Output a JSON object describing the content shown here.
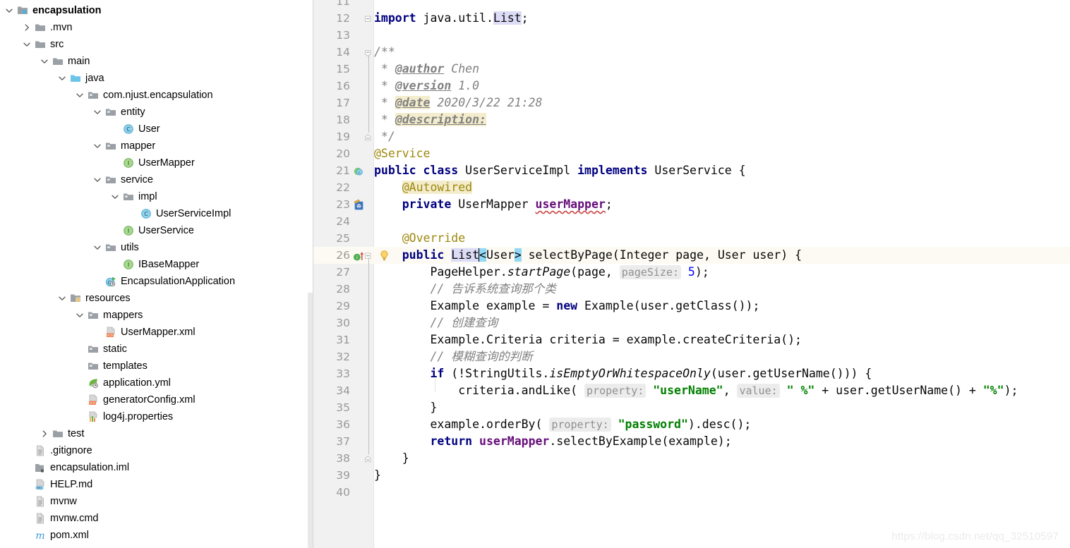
{
  "project_tree": {
    "name": "Project tool window",
    "items": [
      {
        "label": "encapsulation",
        "depth": 0,
        "arrow": "down",
        "icon": "module-folder-icon",
        "bold": true
      },
      {
        "label": ".mvn",
        "depth": 1,
        "arrow": "right",
        "icon": "folder-icon",
        "bold": false
      },
      {
        "label": "src",
        "depth": 1,
        "arrow": "down",
        "icon": "folder-icon",
        "bold": false
      },
      {
        "label": "main",
        "depth": 2,
        "arrow": "down",
        "icon": "folder-icon",
        "bold": false
      },
      {
        "label": "java",
        "depth": 3,
        "arrow": "down",
        "icon": "source-folder-icon",
        "bold": false
      },
      {
        "label": "com.njust.encapsulation",
        "depth": 4,
        "arrow": "down",
        "icon": "package-icon",
        "bold": false
      },
      {
        "label": "entity",
        "depth": 5,
        "arrow": "down",
        "icon": "package-icon",
        "bold": false
      },
      {
        "label": "User",
        "depth": 6,
        "arrow": "none",
        "icon": "java-class-icon",
        "bold": false
      },
      {
        "label": "mapper",
        "depth": 5,
        "arrow": "down",
        "icon": "package-icon",
        "bold": false
      },
      {
        "label": "UserMapper",
        "depth": 6,
        "arrow": "none",
        "icon": "java-interface-icon",
        "bold": false
      },
      {
        "label": "service",
        "depth": 5,
        "arrow": "down",
        "icon": "package-icon",
        "bold": false
      },
      {
        "label": "impl",
        "depth": 6,
        "arrow": "down",
        "icon": "package-icon",
        "bold": false
      },
      {
        "label": "UserServiceImpl",
        "depth": 7,
        "arrow": "none",
        "icon": "java-class-icon",
        "bold": false
      },
      {
        "label": "UserService",
        "depth": 6,
        "arrow": "none",
        "icon": "java-interface-icon",
        "bold": false
      },
      {
        "label": "utils",
        "depth": 5,
        "arrow": "down",
        "icon": "package-icon",
        "bold": false
      },
      {
        "label": "IBaseMapper",
        "depth": 6,
        "arrow": "none",
        "icon": "java-interface-icon",
        "bold": false
      },
      {
        "label": "EncapsulationApplication",
        "depth": 5,
        "arrow": "none",
        "icon": "spring-boot-class-icon",
        "bold": false
      },
      {
        "label": "resources",
        "depth": 3,
        "arrow": "down",
        "icon": "resources-folder-icon",
        "bold": false
      },
      {
        "label": "mappers",
        "depth": 4,
        "arrow": "down",
        "icon": "package-icon",
        "bold": false
      },
      {
        "label": "UserMapper.xml",
        "depth": 5,
        "arrow": "none",
        "icon": "xml-file-icon",
        "bold": false
      },
      {
        "label": "static",
        "depth": 4,
        "arrow": "none",
        "icon": "package-icon",
        "bold": false
      },
      {
        "label": "templates",
        "depth": 4,
        "arrow": "none",
        "icon": "package-icon",
        "bold": false
      },
      {
        "label": "application.yml",
        "depth": 4,
        "arrow": "none",
        "icon": "spring-yml-icon",
        "bold": false
      },
      {
        "label": "generatorConfig.xml",
        "depth": 4,
        "arrow": "none",
        "icon": "xml-file-icon",
        "bold": false
      },
      {
        "label": "log4j.properties",
        "depth": 4,
        "arrow": "none",
        "icon": "properties-file-icon",
        "bold": false
      },
      {
        "label": "test",
        "depth": 2,
        "arrow": "right",
        "icon": "folder-icon",
        "bold": false
      },
      {
        "label": ".gitignore",
        "depth": 1,
        "arrow": "none",
        "icon": "text-file-icon",
        "bold": false
      },
      {
        "label": "encapsulation.iml",
        "depth": 1,
        "arrow": "none",
        "icon": "iml-file-icon",
        "bold": false
      },
      {
        "label": "HELP.md",
        "depth": 1,
        "arrow": "none",
        "icon": "markdown-file-icon",
        "bold": false
      },
      {
        "label": "mvnw",
        "depth": 1,
        "arrow": "none",
        "icon": "text-file-icon",
        "bold": false
      },
      {
        "label": "mvnw.cmd",
        "depth": 1,
        "arrow": "none",
        "icon": "text-file-icon",
        "bold": false
      },
      {
        "label": "pom.xml",
        "depth": 1,
        "arrow": "none",
        "icon": "maven-pom-icon",
        "bold": false
      }
    ]
  },
  "editor": {
    "name": "UserServiceImpl.java",
    "first_visible_line": 11,
    "current_line": 26,
    "caret_line": 26,
    "lines": [
      {
        "n": 12,
        "text": "import java.util.List;"
      },
      {
        "n": 13,
        "text": ""
      },
      {
        "n": 14,
        "text": "/**"
      },
      {
        "n": 15,
        "text": " * @author Chen"
      },
      {
        "n": 16,
        "text": " * @version 1.0"
      },
      {
        "n": 17,
        "text": " * @date 2020/3/22 21:28"
      },
      {
        "n": 18,
        "text": " * @description:"
      },
      {
        "n": 19,
        "text": " */"
      },
      {
        "n": 20,
        "text": "@Service"
      },
      {
        "n": 21,
        "text": "public class UserServiceImpl implements UserService {"
      },
      {
        "n": 22,
        "text": "    @Autowired"
      },
      {
        "n": 23,
        "text": "    private UserMapper userMapper;"
      },
      {
        "n": 24,
        "text": ""
      },
      {
        "n": 25,
        "text": "    @Override"
      },
      {
        "n": 26,
        "text": "    public List<User> selectByPage(Integer page, User user) {"
      },
      {
        "n": 27,
        "text": "        PageHelper.startPage(page,  pageSize: 5);"
      },
      {
        "n": 28,
        "text": "        // 告诉系统查询那个类"
      },
      {
        "n": 29,
        "text": "        Example example = new Example(user.getClass());"
      },
      {
        "n": 30,
        "text": "        // 创建查询"
      },
      {
        "n": 31,
        "text": "        Example.Criteria criteria = example.createCriteria();"
      },
      {
        "n": 32,
        "text": "        // 模糊查询的判断"
      },
      {
        "n": 33,
        "text": "        if (!StringUtils.isEmptyOrWhitespaceOnly(user.getUserName())) {"
      },
      {
        "n": 34,
        "text": "            criteria.andLike( property: \"userName\",  value: \" %\" + user.getUserName() + \"%\");"
      },
      {
        "n": 35,
        "text": "        }"
      },
      {
        "n": 36,
        "text": "        example.orderBy( property: \"password\").desc();"
      },
      {
        "n": 37,
        "text": "        return userMapper.selectByExample(example);"
      },
      {
        "n": 38,
        "text": "    }"
      },
      {
        "n": 39,
        "text": "}"
      },
      {
        "n": 40,
        "text": ""
      }
    ],
    "gutter_icons": {
      "line_21": "implementing-class-icon",
      "line_23": "spring-bean-autowired-icon",
      "line_26": "overriding-method-icon",
      "line_26_intention": "intention-bulb-icon"
    },
    "parameter_hints": [
      {
        "line": 27,
        "label": "pageSize:"
      },
      {
        "line": 34,
        "label": "property:"
      },
      {
        "line": 34,
        "label": "value:"
      },
      {
        "line": 36,
        "label": "property:"
      }
    ]
  },
  "watermark": {
    "text": "https://blog.csdn.net/qq_32510597"
  },
  "colors": {
    "keyword": "#000080",
    "string": "#008000",
    "number": "#0000ff",
    "comment": "#808080",
    "annotation": "#9e880d",
    "field": "#660e7a",
    "current_line_bg": "#fcfaf2",
    "gutter_bg": "#f1f1f1",
    "identifier_highlight": "#dcdcf7",
    "bracket_highlight": "#93d9f5"
  }
}
